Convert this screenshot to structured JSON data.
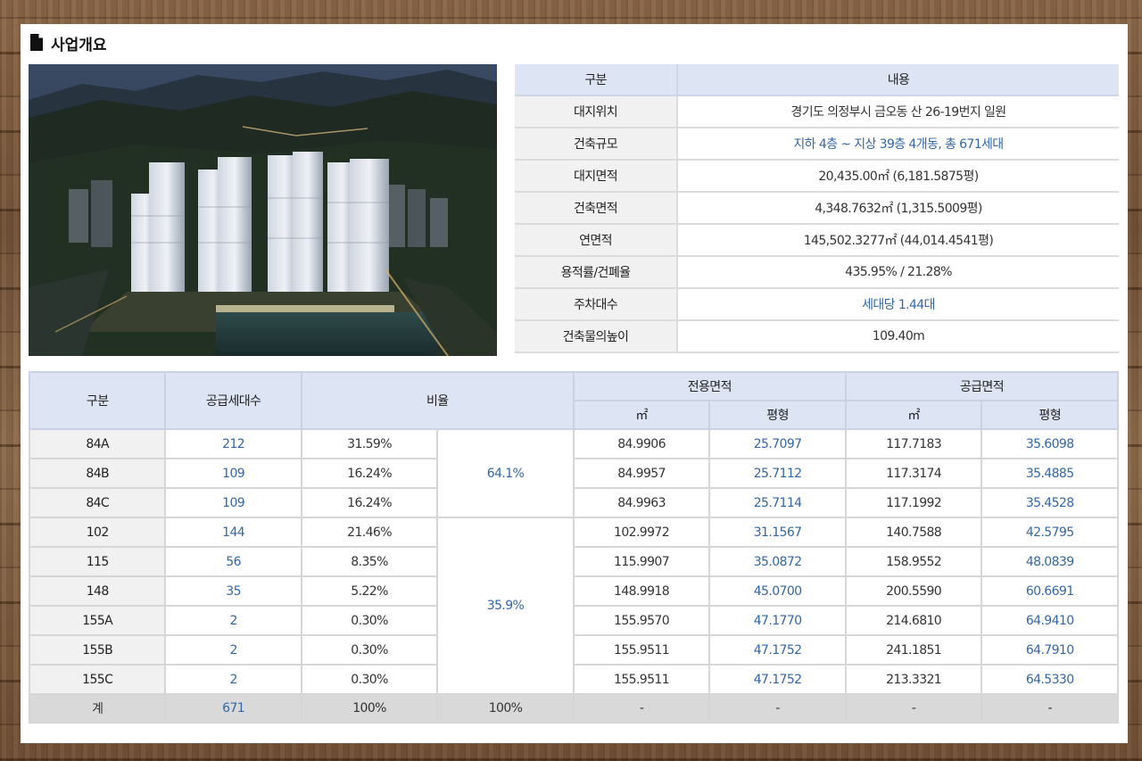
{
  "section": {
    "title": "사업개요",
    "icon": "document-icon"
  },
  "photo": {
    "icon": "building-photo"
  },
  "info": {
    "header": {
      "key": "구분",
      "value": "내용"
    },
    "rows": [
      {
        "key": "대지위치",
        "value": "경기도 의정부시 금오동 산 26-19번지 일원",
        "highlight": false
      },
      {
        "key": "건축규모",
        "value": "지하 4층 ~ 지상 39층 4개동, 총 671세대",
        "highlight": true
      },
      {
        "key": "대지면적",
        "value": "20,435.00㎡ (6,181.5875평)",
        "highlight": false
      },
      {
        "key": "건축면적",
        "value": "4,348.7632㎡ (1,315.5009평)",
        "highlight": false
      },
      {
        "key": "연면적",
        "value": "145,502.3277㎡ (44,014.4541평)",
        "highlight": false
      },
      {
        "key": "용적률/건폐율",
        "value": "435.95% / 21.28%",
        "highlight": false
      },
      {
        "key": "주차대수",
        "value": "세대당 1.44대",
        "highlight": true
      },
      {
        "key": "건축물의높이",
        "value": "109.40m",
        "highlight": false
      }
    ]
  },
  "units": {
    "headers": {
      "type": "구분",
      "supply_count": "공급세대수",
      "ratio": "비율",
      "exclusive_area": "전용면적",
      "supply_area": "공급면적",
      "sqm": "㎡",
      "pyeong": "평형"
    },
    "group_ratios": [
      "64.1%",
      "35.9%"
    ],
    "rows": [
      {
        "type": "84A",
        "count": "212",
        "ratio": "31.59%",
        "ex_m2": "84.9906",
        "ex_py": "25.7097",
        "sup_m2": "117.7183",
        "sup_py": "35.6098"
      },
      {
        "type": "84B",
        "count": "109",
        "ratio": "16.24%",
        "ex_m2": "84.9957",
        "ex_py": "25.7112",
        "sup_m2": "117.3174",
        "sup_py": "35.4885"
      },
      {
        "type": "84C",
        "count": "109",
        "ratio": "16.24%",
        "ex_m2": "84.9963",
        "ex_py": "25.7114",
        "sup_m2": "117.1992",
        "sup_py": "35.4528"
      },
      {
        "type": "102",
        "count": "144",
        "ratio": "21.46%",
        "ex_m2": "102.9972",
        "ex_py": "31.1567",
        "sup_m2": "140.7588",
        "sup_py": "42.5795"
      },
      {
        "type": "115",
        "count": "56",
        "ratio": "8.35%",
        "ex_m2": "115.9907",
        "ex_py": "35.0872",
        "sup_m2": "158.9552",
        "sup_py": "48.0839"
      },
      {
        "type": "148",
        "count": "35",
        "ratio": "5.22%",
        "ex_m2": "148.9918",
        "ex_py": "45.0700",
        "sup_m2": "200.5590",
        "sup_py": "60.6691"
      },
      {
        "type": "155A",
        "count": "2",
        "ratio": "0.30%",
        "ex_m2": "155.9570",
        "ex_py": "47.1770",
        "sup_m2": "214.6810",
        "sup_py": "64.9410"
      },
      {
        "type": "155B",
        "count": "2",
        "ratio": "0.30%",
        "ex_m2": "155.9511",
        "ex_py": "47.1752",
        "sup_m2": "241.1851",
        "sup_py": "64.7910"
      },
      {
        "type": "155C",
        "count": "2",
        "ratio": "0.30%",
        "ex_m2": "155.9511",
        "ex_py": "47.1752",
        "sup_m2": "213.3321",
        "sup_py": "64.5330"
      }
    ],
    "total": {
      "type": "계",
      "count": "671",
      "ratio": "100%",
      "group": "100%",
      "ex_m2": "-",
      "ex_py": "-",
      "sup_m2": "-",
      "sup_py": "-"
    }
  }
}
